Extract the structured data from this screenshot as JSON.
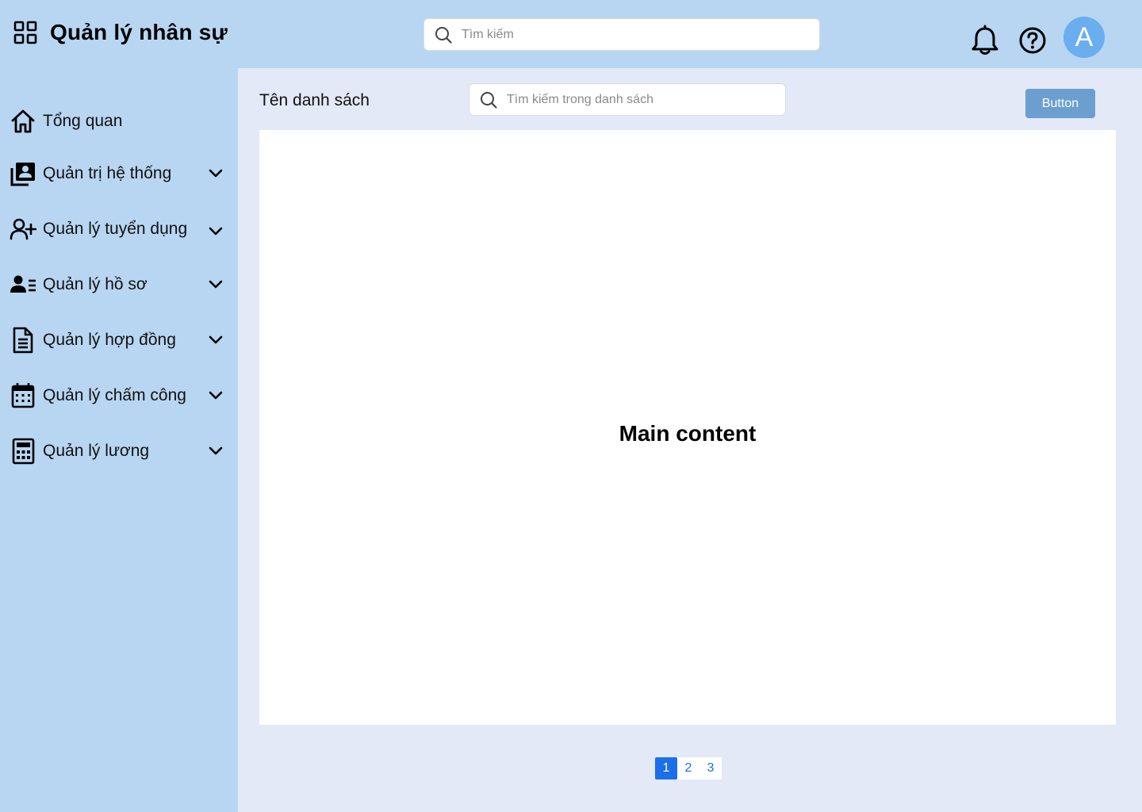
{
  "header": {
    "app_title": "Quản lý nhân sự",
    "search_placeholder": "Tìm kiếm",
    "avatar_initial": "A"
  },
  "sidebar": {
    "items": [
      {
        "label": "Tổng quan",
        "icon": "home-icon",
        "has_submenu": false
      },
      {
        "label": "Quản trị hệ thống",
        "icon": "admin-profile-icon",
        "has_submenu": true
      },
      {
        "label": "Quản lý tuyển dụng",
        "icon": "user-add-icon",
        "has_submenu": true
      },
      {
        "label": "Quản lý hồ sơ",
        "icon": "user-list-icon",
        "has_submenu": true
      },
      {
        "label": "Quản lý hợp đồng",
        "icon": "document-icon",
        "has_submenu": true
      },
      {
        "label": "Quản lý chấm công",
        "icon": "calendar-icon",
        "has_submenu": true
      },
      {
        "label": "Quản lý lương",
        "icon": "calculator-icon",
        "has_submenu": true
      }
    ]
  },
  "main": {
    "list_title": "Tên danh sách",
    "list_search_placeholder": "Tìm kiếm trong danh sách",
    "button_label": "Button",
    "content_placeholder": "Main content",
    "pagination": {
      "pages": [
        "1",
        "2",
        "3"
      ],
      "current": "1"
    }
  },
  "colors": {
    "sidebar_bg": "#b8d6f2",
    "main_bg": "#e3e9f7",
    "primary_button": "#6b9fd0",
    "avatar": "#6aaef0",
    "page_active": "#1b6fe8"
  }
}
